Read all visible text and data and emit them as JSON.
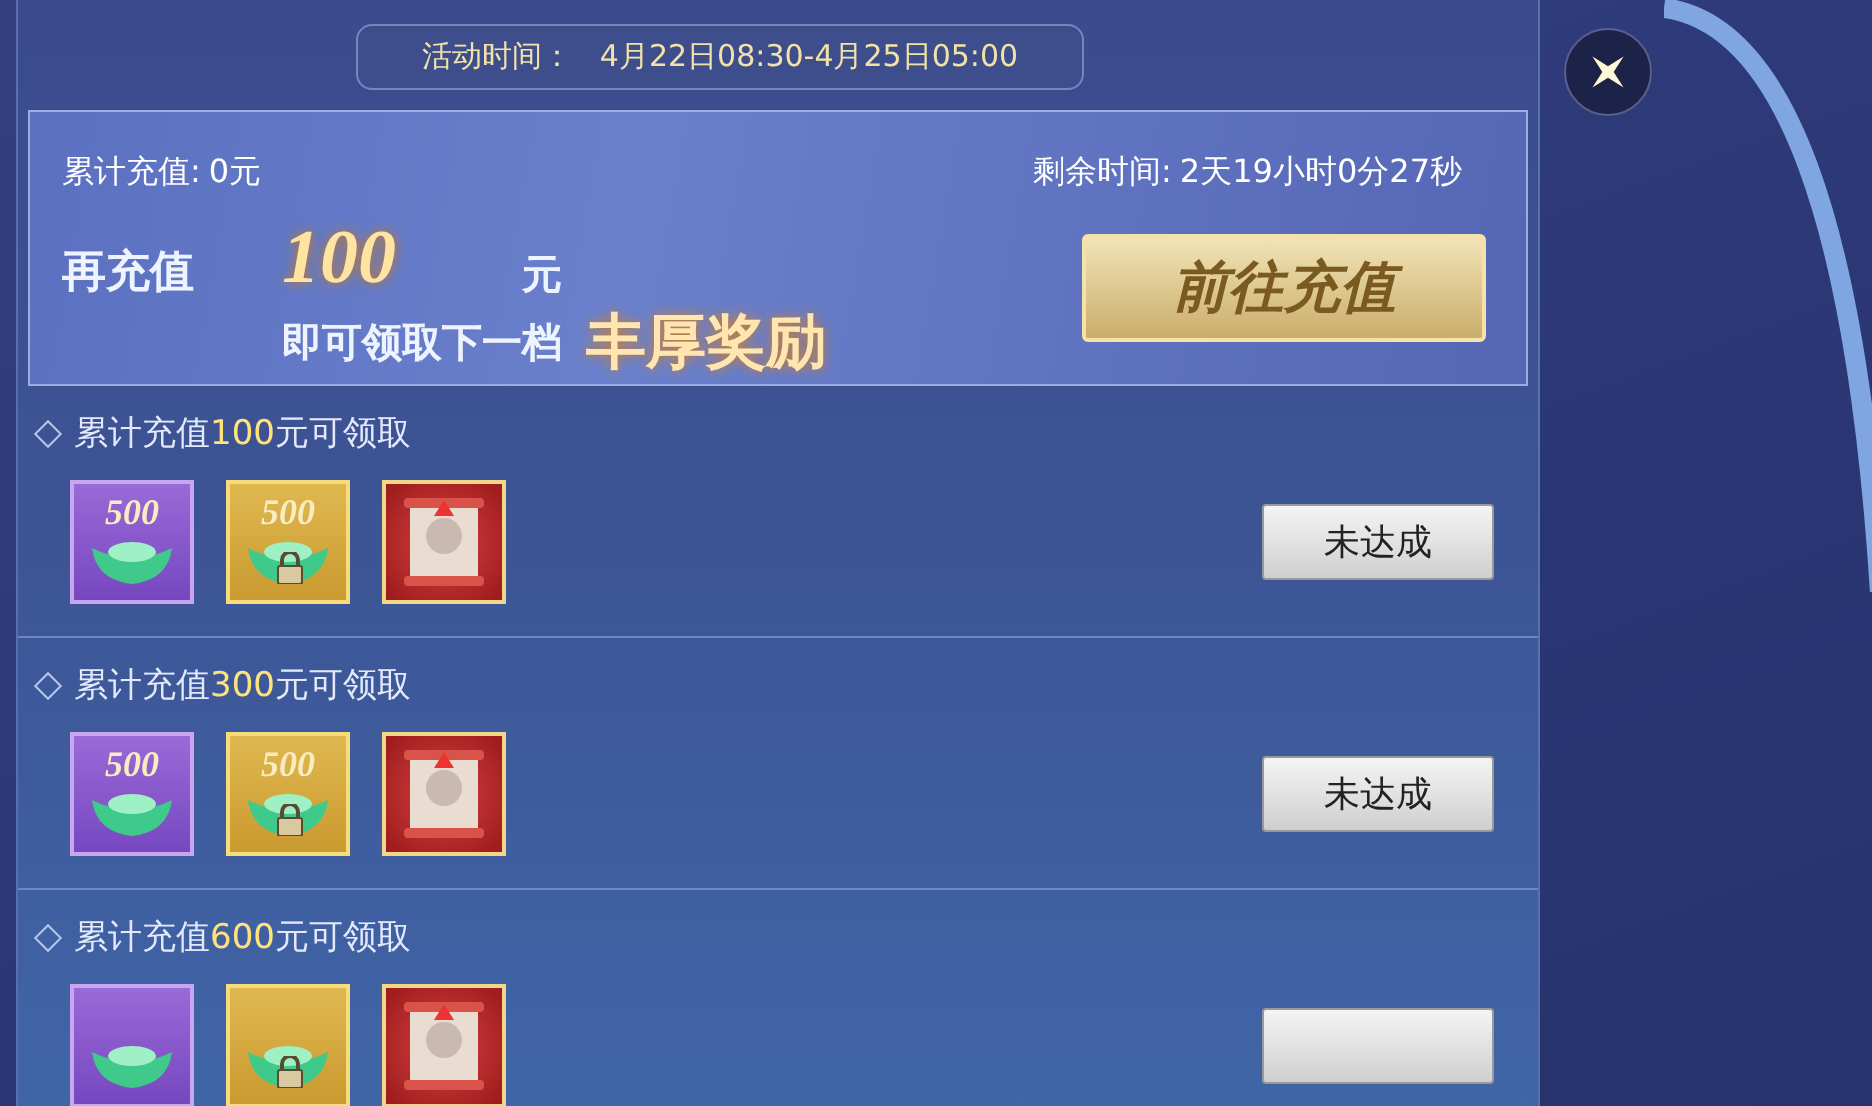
{
  "header": {
    "label": "活动时间：",
    "period": "4月22日08:30-4月25日05:00"
  },
  "banner": {
    "total_label": "累计充值:",
    "total_value": "0元",
    "remaining_label": "剩余时间:",
    "remaining_value": "2天19小时0分27秒",
    "prompt": "再充值",
    "amount": "100",
    "unit": "元",
    "subline": "即可领取下一档",
    "highlight": "丰厚奖励",
    "button": "前往充值"
  },
  "tiers": [
    {
      "title_before": "累计充值",
      "amount": "100",
      "title_after": "元可领取",
      "rewards": [
        {
          "kind": "ingot",
          "count": "500"
        },
        {
          "kind": "locked-ingot",
          "count": "500"
        },
        {
          "kind": "scroll"
        }
      ],
      "button": "未达成"
    },
    {
      "title_before": "累计充值",
      "amount": "300",
      "title_after": "元可领取",
      "rewards": [
        {
          "kind": "ingot",
          "count": "500"
        },
        {
          "kind": "locked-ingot",
          "count": "500"
        },
        {
          "kind": "scroll"
        }
      ],
      "button": "未达成"
    },
    {
      "title_before": "累计充值",
      "amount": "600",
      "title_after": "元可领取",
      "rewards": [
        {
          "kind": "ingot"
        },
        {
          "kind": "locked-ingot"
        },
        {
          "kind": "scroll"
        }
      ]
    }
  ]
}
